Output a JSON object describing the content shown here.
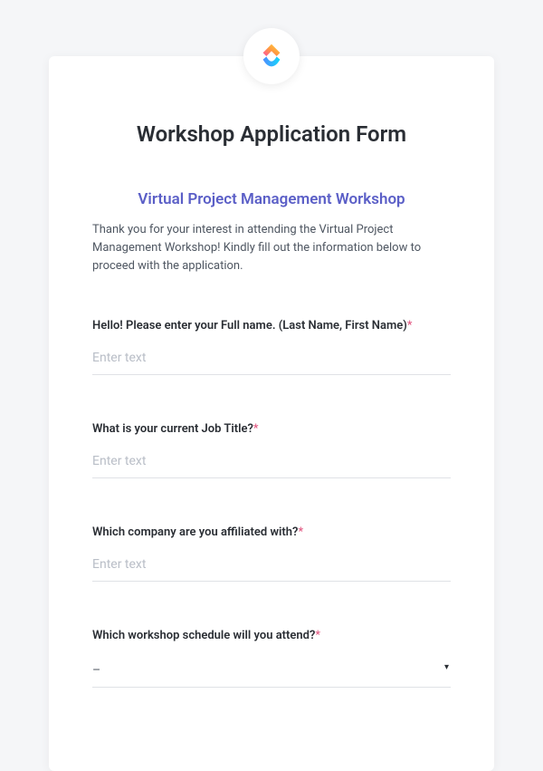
{
  "header": {
    "title": "Workshop Application Form"
  },
  "subtitle": "Virtual Project Management Workshop",
  "intro": "Thank you for your interest in attending the Virtual Project Management Workshop! Kindly fill out the information below to proceed with the application.",
  "fields": {
    "fullname": {
      "label": "Hello! Please enter your Full name. (Last Name, First Name)",
      "required": "*",
      "placeholder": "Enter text"
    },
    "jobtitle": {
      "label": "What is your current Job Title?",
      "required": "*",
      "placeholder": "Enter text"
    },
    "company": {
      "label": "Which company are you affiliated with?",
      "required": "*",
      "placeholder": "Enter text"
    },
    "schedule": {
      "label": "Which workshop schedule will you attend?",
      "required": "*",
      "selected": "–"
    }
  }
}
